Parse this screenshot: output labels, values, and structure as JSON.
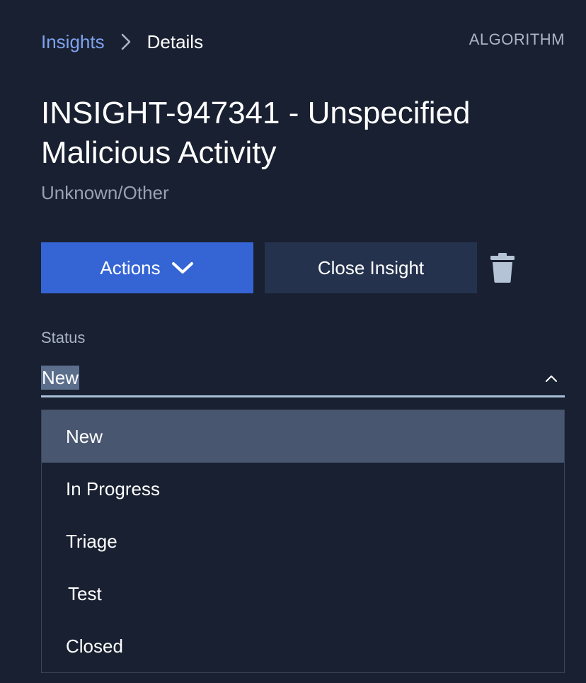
{
  "breadcrumb": {
    "parent": "Insights",
    "current": "Details"
  },
  "tag": "ALGORITHM",
  "insight": {
    "title": "INSIGHT-947341 - Unspecified Malicious Activity",
    "subtitle": "Unknown/Other"
  },
  "buttons": {
    "actions": "Actions",
    "close_insight": "Close Insight"
  },
  "icons": {
    "breadcrumb_separator": "chevron-right-icon",
    "actions_dropdown": "chevron-down-icon",
    "delete": "trash-icon",
    "select_toggle": "chevron-up-icon"
  },
  "status": {
    "label": "Status",
    "selected": "New",
    "options": [
      "New",
      "In Progress",
      "Triage",
      "Test",
      "Closed"
    ]
  },
  "colors": {
    "background": "#192031",
    "primary_button": "#3565d5",
    "secondary_button": "#25324d",
    "link": "#7ea2ef",
    "active_option": "#48566f"
  }
}
